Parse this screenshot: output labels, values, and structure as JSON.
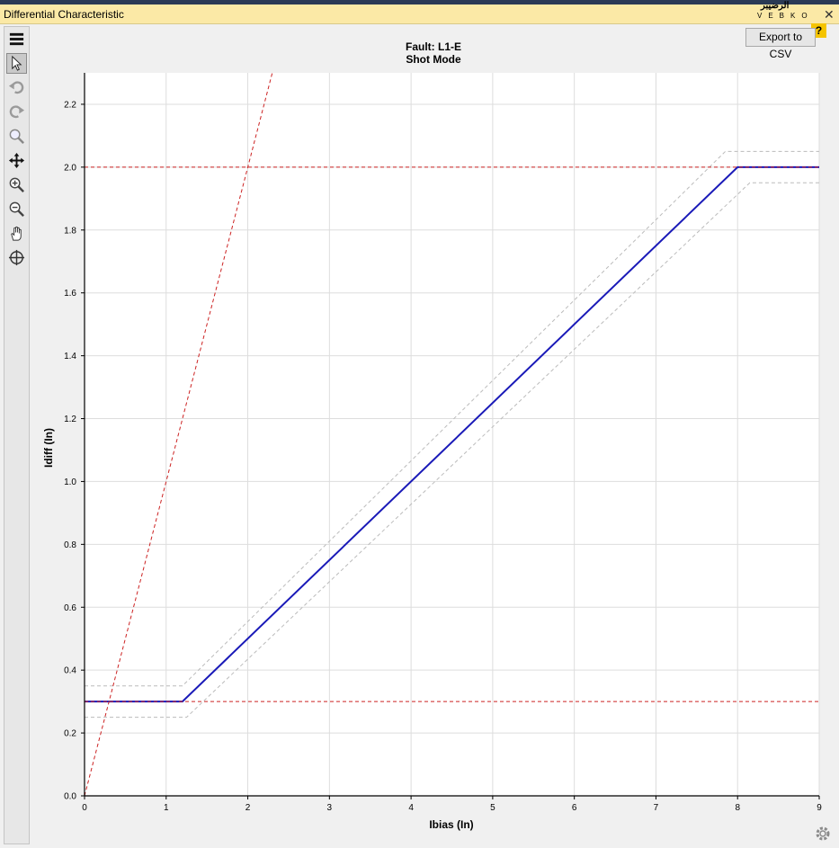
{
  "window": {
    "title": "Differential Characteristic",
    "brand_text": "الرضيبر",
    "brand_letters": "VEBKO",
    "close_glyph": "✕"
  },
  "buttons": {
    "export_label": "Export to CSV",
    "help_label": "?"
  },
  "toolbar": {
    "tools": [
      {
        "icon": "menu-icon",
        "active": false
      },
      {
        "icon": "pointer-icon",
        "active": true
      },
      {
        "icon": "undo-icon",
        "active": false
      },
      {
        "icon": "redo-icon",
        "active": false
      },
      {
        "icon": "zoom-icon",
        "active": false
      },
      {
        "icon": "move-icon",
        "active": false
      },
      {
        "icon": "zoom-in-icon",
        "active": false
      },
      {
        "icon": "zoom-out-icon",
        "active": false
      },
      {
        "icon": "pan-hand-icon",
        "active": false
      },
      {
        "icon": "crosshair-icon",
        "active": false
      }
    ]
  },
  "chart_data": {
    "type": "line",
    "title": "Fault: L1-E",
    "subtitle": "Shot Mode",
    "xlabel": "Ibias (In)",
    "ylabel": "Idiff (In)",
    "xlim": [
      0,
      9
    ],
    "ylim": [
      0,
      2.3
    ],
    "xticks": [
      "0",
      "1",
      "2",
      "3",
      "4",
      "5",
      "6",
      "7",
      "8",
      "9"
    ],
    "yticks": [
      "0.0",
      "0.2",
      "0.4",
      "0.6",
      "0.8",
      "1.0",
      "1.2",
      "1.4",
      "1.6",
      "1.8",
      "2.0",
      "2.2"
    ],
    "grid": true,
    "series": [
      {
        "style": "solid",
        "color": "#1a1ab8",
        "x": [
          0,
          1.2,
          8.0,
          9.0
        ],
        "y": [
          0.3,
          0.3,
          2.0,
          2.0
        ]
      },
      {
        "style": "dashed",
        "color": "#bbbbbb",
        "x": [
          0,
          1.2,
          7.85,
          9.0
        ],
        "y": [
          0.35,
          0.35,
          2.05,
          2.05
        ]
      },
      {
        "style": "dashed",
        "color": "#bbbbbb",
        "x": [
          0,
          1.25,
          8.15,
          9.0
        ],
        "y": [
          0.25,
          0.25,
          1.95,
          1.95
        ]
      },
      {
        "style": "dashed",
        "color": "#cc2222",
        "x": [
          0,
          2.3
        ],
        "y": [
          0,
          2.3
        ]
      },
      {
        "style": "dashed",
        "color": "#cc2222",
        "x": [
          0,
          9.0
        ],
        "y": [
          2.0,
          2.0
        ]
      },
      {
        "style": "dashed",
        "color": "#cc2222",
        "x": [
          0,
          9.0
        ],
        "y": [
          0.3,
          0.3
        ]
      }
    ]
  }
}
